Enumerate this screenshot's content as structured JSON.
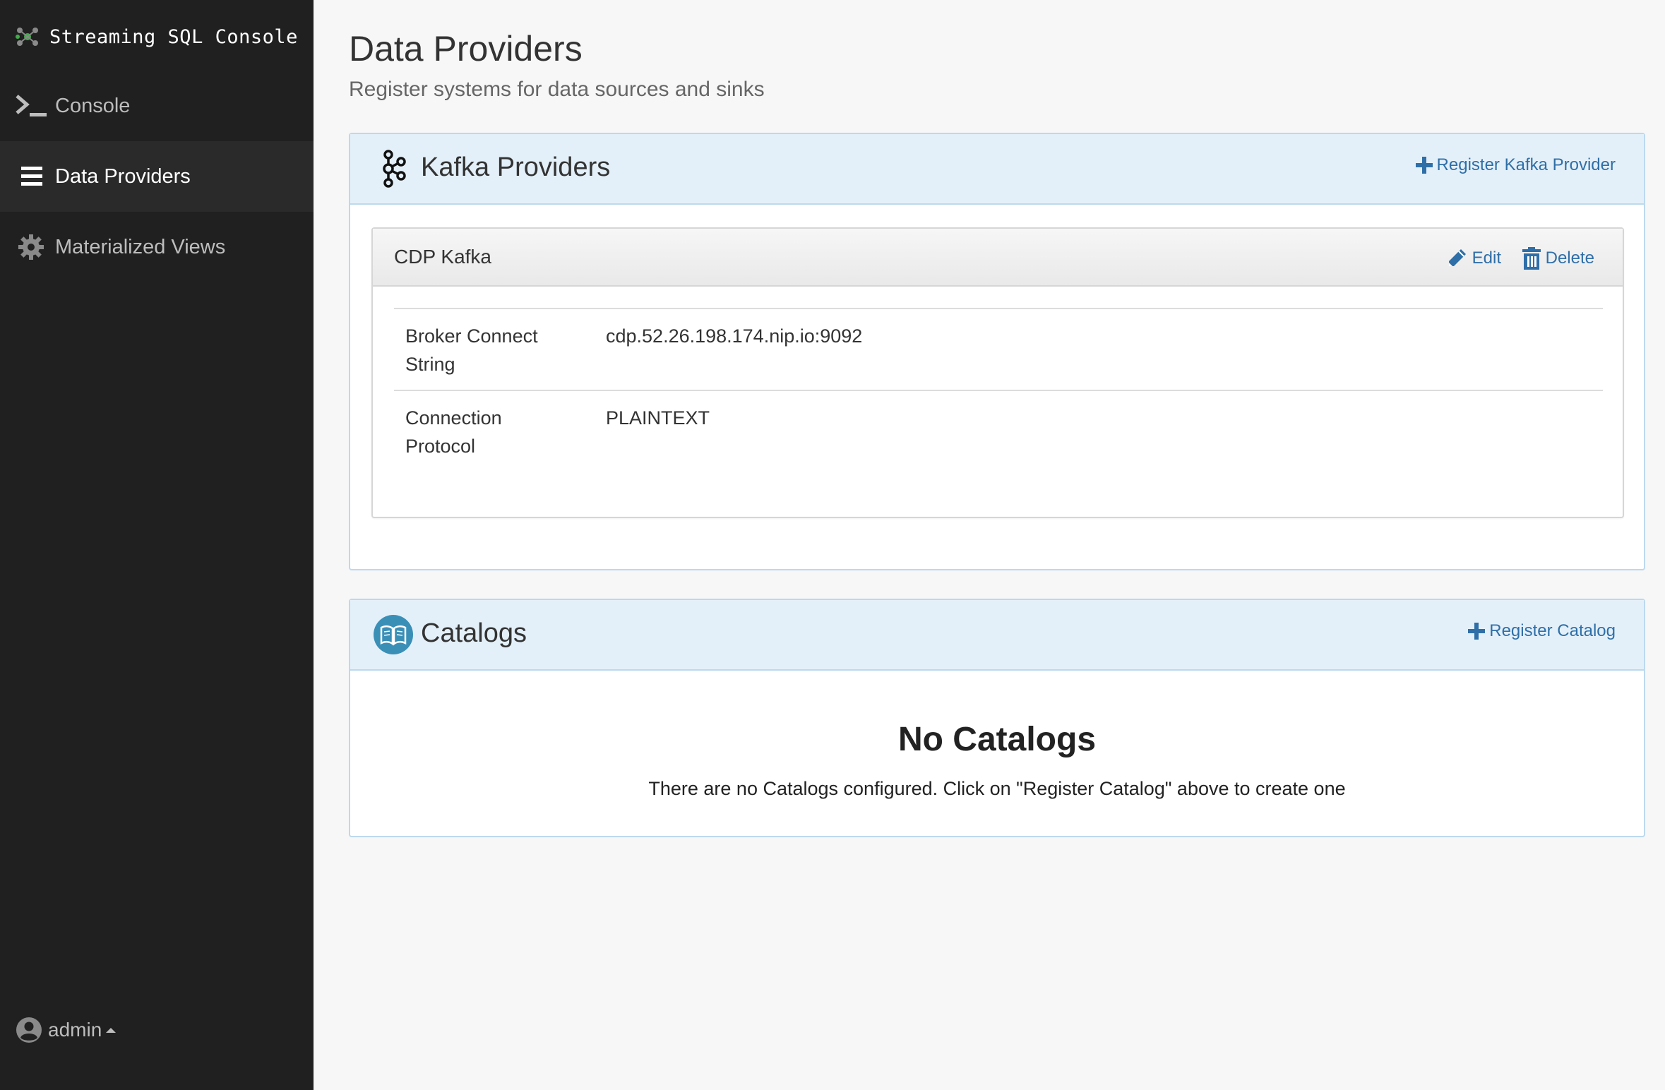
{
  "sidebar": {
    "brand": {
      "title": "Streaming SQL Console",
      "icon": "cluster-logo-icon"
    },
    "items": [
      {
        "label": "Console",
        "icon": "terminal-icon",
        "active": false
      },
      {
        "label": "Data Providers",
        "icon": "list-icon",
        "active": true
      },
      {
        "label": "Materialized Views",
        "icon": "gear-icon",
        "active": false
      }
    ],
    "user": {
      "name": "admin",
      "icon": "user-circle-icon"
    }
  },
  "page": {
    "title": "Data Providers",
    "subtitle": "Register systems for data sources and sinks"
  },
  "kafka": {
    "title": "Kafka Providers",
    "icon": "kafka-icon",
    "register_label": "Register Kafka Provider",
    "provider": {
      "name": "CDP Kafka",
      "edit_label": "Edit",
      "delete_label": "Delete",
      "fields": [
        {
          "key": "Broker Connect String",
          "value": "cdp.52.26.198.174.nip.io:9092"
        },
        {
          "key": "Connection Protocol",
          "value": "PLAINTEXT"
        }
      ]
    }
  },
  "catalogs": {
    "title": "Catalogs",
    "icon": "book-icon",
    "register_label": "Register Catalog",
    "empty_title": "No Catalogs",
    "empty_text": "There are no Catalogs configured. Click on \"Register Catalog\" above to create one"
  },
  "colors": {
    "sidebar_bg": "#202020",
    "panel_heading_bg": "#e4f0f9",
    "link": "#2f6fa8",
    "catalog_icon_bg": "#3a8fb7"
  }
}
